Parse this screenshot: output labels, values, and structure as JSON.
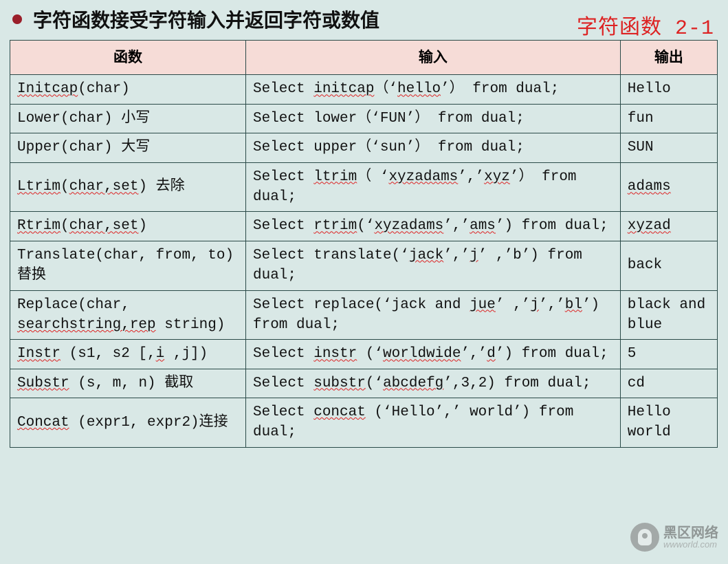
{
  "header": {
    "title": "字符函数接受字符输入并返回字符或数值",
    "subtitle": "字符函数 2-1"
  },
  "columns": {
    "fn": "函数",
    "input": "输入",
    "output": "输出"
  },
  "rows": [
    {
      "fn": [
        {
          "t": "Initcap",
          "w": true
        },
        {
          "t": "(char)"
        }
      ],
      "input": [
        {
          "t": "Select "
        },
        {
          "t": "initcap",
          "w": true
        },
        {
          "t": "（‘"
        },
        {
          "t": "hello",
          "w": true
        },
        {
          "t": "’） from dual;"
        }
      ],
      "output": [
        {
          "t": "Hello"
        }
      ]
    },
    {
      "fn": [
        {
          "t": "Lower(char) 小写"
        }
      ],
      "input": [
        {
          "t": "Select lower（‘FUN’） from dual;"
        }
      ],
      "output": [
        {
          "t": "fun"
        }
      ]
    },
    {
      "fn": [
        {
          "t": "Upper(char) 大写"
        }
      ],
      "input": [
        {
          "t": "Select upper（‘sun’） from dual;"
        }
      ],
      "output": [
        {
          "t": "SUN"
        }
      ]
    },
    {
      "fn": [
        {
          "t": "Ltrim",
          "w": true
        },
        {
          "t": "("
        },
        {
          "t": "char,set",
          "w": true
        },
        {
          "t": ") 去除"
        }
      ],
      "input": [
        {
          "t": "Select "
        },
        {
          "t": "ltrim",
          "w": true
        },
        {
          "t": "（ ‘"
        },
        {
          "t": "xyzadams",
          "w": true
        },
        {
          "t": "’,’"
        },
        {
          "t": "xyz",
          "w": true
        },
        {
          "t": "’） from dual;"
        }
      ],
      "output": [
        {
          "t": "adams",
          "w": true
        }
      ]
    },
    {
      "fn": [
        {
          "t": "Rtrim",
          "w": true
        },
        {
          "t": "("
        },
        {
          "t": "char,set",
          "w": true
        },
        {
          "t": ")"
        }
      ],
      "input": [
        {
          "t": "Select "
        },
        {
          "t": "rtrim",
          "w": true
        },
        {
          "t": "(‘"
        },
        {
          "t": "xyzadams",
          "w": true
        },
        {
          "t": "’,’"
        },
        {
          "t": "ams",
          "w": true
        },
        {
          "t": "’) from dual;"
        }
      ],
      "output": [
        {
          "t": "xyzad",
          "w": true
        }
      ]
    },
    {
      "fn": [
        {
          "t": "Translate(char, from, to) 替换"
        }
      ],
      "input": [
        {
          "t": "Select translate(‘"
        },
        {
          "t": "jack",
          "w": true
        },
        {
          "t": "’,’"
        },
        {
          "t": "j",
          "w": true
        },
        {
          "t": "’ ,’b’) from dual;"
        }
      ],
      "output": [
        {
          "t": "back"
        }
      ]
    },
    {
      "fn": [
        {
          "t": "Replace(char, "
        },
        {
          "t": "searchstring,rep",
          "w": true
        },
        {
          "t": " string)"
        }
      ],
      "input": [
        {
          "t": "Select replace(‘jack and "
        },
        {
          "t": "jue",
          "w": true
        },
        {
          "t": "’ ,’"
        },
        {
          "t": "j",
          "w": true
        },
        {
          "t": "’,’"
        },
        {
          "t": "bl",
          "w": true
        },
        {
          "t": "’) from dual;"
        }
      ],
      "output": [
        {
          "t": "black and blue"
        }
      ]
    },
    {
      "fn": [
        {
          "t": "Instr",
          "w": true
        },
        {
          "t": " (s1, s2 [,"
        },
        {
          "t": "i",
          "w": true
        },
        {
          "t": " ,j])"
        }
      ],
      "input": [
        {
          "t": "Select "
        },
        {
          "t": "instr",
          "w": true
        },
        {
          "t": " (‘"
        },
        {
          "t": "worldwide",
          "w": true
        },
        {
          "t": "’,’"
        },
        {
          "t": "d",
          "w": true
        },
        {
          "t": "’) from dual;"
        }
      ],
      "output": [
        {
          "t": "5"
        }
      ]
    },
    {
      "fn": [
        {
          "t": "Substr",
          "w": true
        },
        {
          "t": " (s, m, n) 截取"
        }
      ],
      "input": [
        {
          "t": "Select "
        },
        {
          "t": "substr",
          "w": true
        },
        {
          "t": "(‘"
        },
        {
          "t": "abcdefg",
          "w": true
        },
        {
          "t": "’,3,2) from dual;"
        }
      ],
      "output": [
        {
          "t": "cd"
        }
      ]
    },
    {
      "fn": [
        {
          "t": "Concat",
          "w": true
        },
        {
          "t": " (expr1, expr2)连接"
        }
      ],
      "input": [
        {
          "t": "Select "
        },
        {
          "t": "concat",
          "w": true
        },
        {
          "t": " (‘Hello’,’ world’) from dual;"
        }
      ],
      "output": [
        {
          "t": "Hello world"
        }
      ]
    }
  ],
  "watermark": {
    "cn": "黑区网络",
    "url": "wwworld.com"
  }
}
